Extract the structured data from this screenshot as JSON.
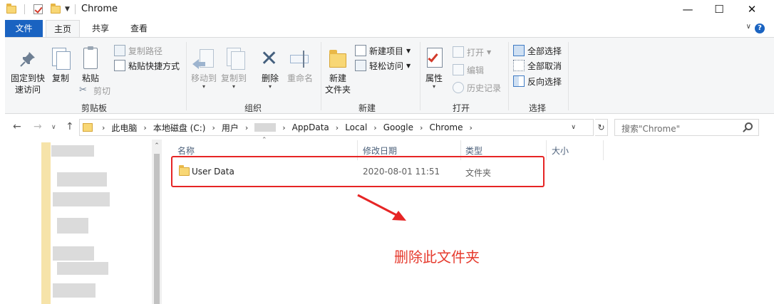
{
  "window": {
    "title": "Chrome",
    "minimize": "—",
    "maximize": "☐",
    "close": "✕"
  },
  "tabs": {
    "file": "文件",
    "home": "主页",
    "share": "共享",
    "view": "查看",
    "help": "?"
  },
  "ribbon": {
    "clipboard": {
      "label": "剪贴板",
      "pin_line1": "固定到快",
      "pin_line2": "速访问",
      "copy": "复制",
      "paste": "粘贴",
      "copy_path": "复制路径",
      "paste_shortcut": "粘贴快捷方式",
      "cut": "剪切"
    },
    "organize": {
      "label": "组织",
      "move_to": "移动到",
      "copy_to": "复制到",
      "delete": "删除",
      "rename": "重命名"
    },
    "new": {
      "label": "新建",
      "new_folder_line1": "新建",
      "new_folder_line2": "文件夹",
      "new_item": "新建项目",
      "easy_access": "轻松访问"
    },
    "open": {
      "label": "打开",
      "properties": "属性",
      "open": "打开",
      "edit": "编辑",
      "history": "历史记录"
    },
    "select": {
      "label": "选择",
      "select_all": "全部选择",
      "select_none": "全部取消",
      "invert": "反向选择"
    }
  },
  "address": {
    "crumbs": [
      "此电脑",
      "本地磁盘 (C:)",
      "用户",
      "AppData",
      "Local",
      "Google",
      "Chrome"
    ]
  },
  "search": {
    "placeholder": "搜索\"Chrome\""
  },
  "columns": {
    "name": "名称",
    "modified": "修改日期",
    "type": "类型",
    "size": "大小"
  },
  "files": [
    {
      "name": "User Data",
      "modified": "2020-08-01 11:51",
      "type": "文件夹",
      "size": ""
    }
  ],
  "annotation": {
    "text": "删除此文件夹",
    "color": "#e63b2e"
  },
  "colors": {
    "accent": "#1a63c1",
    "highlight_box": "#e62525",
    "folder": "#f8d775"
  }
}
